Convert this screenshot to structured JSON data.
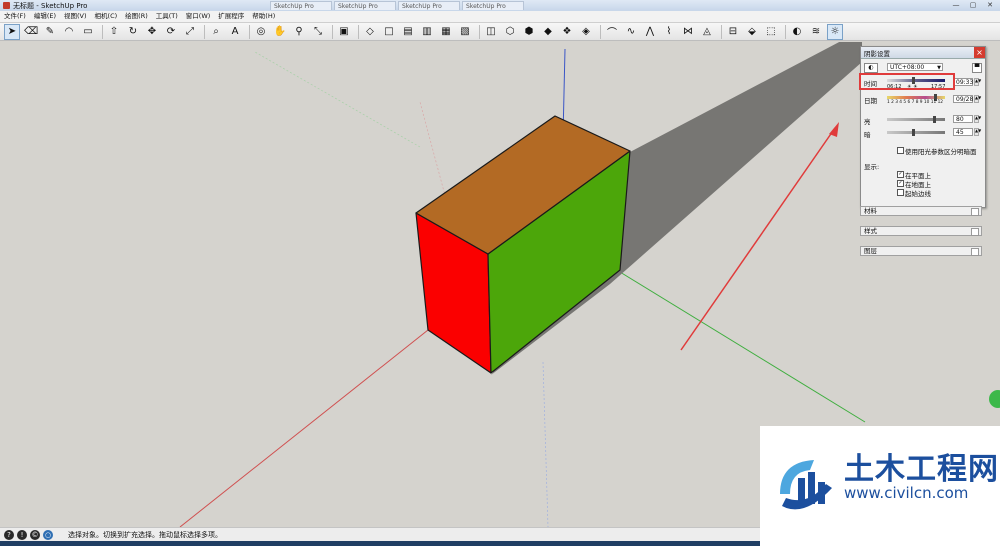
{
  "window": {
    "title": "无标题 - SketchUp Pro",
    "tabs": [
      "SketchUp Pro",
      "SketchUp Pro",
      "SketchUp Pro",
      "SketchUp Pro"
    ],
    "controls": {
      "minimize": "—",
      "maximize": "▢",
      "close": "✕"
    }
  },
  "menu": [
    "文件(F)",
    "编辑(E)",
    "视图(V)",
    "相机(C)",
    "绘图(R)",
    "工具(T)",
    "窗口(W)",
    "扩展程序",
    "帮助(H)"
  ],
  "toolbar": {
    "tools": [
      {
        "name": "select-tool",
        "glyph": "➤",
        "active": true
      },
      {
        "name": "eraser-tool",
        "glyph": "⌫"
      },
      {
        "name": "pencil-tool",
        "glyph": "✎"
      },
      {
        "name": "arc-tool",
        "glyph": "◠"
      },
      {
        "name": "rectangle-tool",
        "glyph": "▭"
      },
      {
        "name": "pushpull-tool",
        "glyph": "⇧"
      },
      {
        "name": "followme-tool",
        "glyph": "↻"
      },
      {
        "name": "move-tool",
        "glyph": "✥"
      },
      {
        "name": "rotate-tool",
        "glyph": "⟳"
      },
      {
        "name": "scale-tool",
        "glyph": "⤢"
      },
      {
        "name": "tape-tool",
        "glyph": "⌕"
      },
      {
        "name": "text-tool",
        "glyph": "A"
      },
      {
        "name": "orbit-tool",
        "glyph": "◎"
      },
      {
        "name": "pan-tool",
        "glyph": "✋"
      },
      {
        "name": "zoom-tool",
        "glyph": "⚲"
      },
      {
        "name": "zoom-extents-tool",
        "glyph": "⤡"
      },
      {
        "name": "warehouse-tool",
        "glyph": "▣"
      },
      {
        "name": "iso-view",
        "glyph": "◇"
      },
      {
        "name": "top-view",
        "glyph": "□"
      },
      {
        "name": "front-view",
        "glyph": "▤"
      },
      {
        "name": "right-view",
        "glyph": "▥"
      },
      {
        "name": "back-view",
        "glyph": "▦"
      },
      {
        "name": "left-view",
        "glyph": "▧"
      },
      {
        "name": "xray-style",
        "glyph": "◫"
      },
      {
        "name": "wireframe-style",
        "glyph": "⬡"
      },
      {
        "name": "hidden-style",
        "glyph": "⬢"
      },
      {
        "name": "shaded-style",
        "glyph": "◆"
      },
      {
        "name": "textured-style",
        "glyph": "❖"
      },
      {
        "name": "monochrome-style",
        "glyph": "◈"
      },
      {
        "name": "sandbox-1",
        "glyph": "⌒"
      },
      {
        "name": "sandbox-2",
        "glyph": "∿"
      },
      {
        "name": "sandbox-3",
        "glyph": "⋀"
      },
      {
        "name": "sandbox-4",
        "glyph": "⌇"
      },
      {
        "name": "sandbox-5",
        "glyph": "⋈"
      },
      {
        "name": "sandbox-6",
        "glyph": "◬"
      },
      {
        "name": "section-tool",
        "glyph": "⊟"
      },
      {
        "name": "component-tool",
        "glyph": "⬙"
      },
      {
        "name": "group-tool",
        "glyph": "⬚"
      },
      {
        "name": "shadows-toggle",
        "glyph": "◐"
      },
      {
        "name": "fog-toggle",
        "glyph": "≋"
      },
      {
        "name": "shadow-settings",
        "glyph": "☼",
        "active": true
      }
    ]
  },
  "scene": {
    "colors": {
      "top": "#b36a24",
      "front": "#4ca60a",
      "left": "#fb0000",
      "shadow": "#777673",
      "ground": "#d5d3ce",
      "axis_red": "#d05050",
      "axis_green": "#3fae3f",
      "axis_blue": "#3a55c6",
      "annotation": "#e03b3b"
    }
  },
  "shadow_panel": {
    "title": "阴影设置",
    "timezone": "UTC+08:00",
    "time_label": "时间",
    "time_start": "06:12",
    "time_end": "17:57",
    "time_value": "09:33",
    "date_label": "日期",
    "date_ticks": "1 2 3 4 5 6 7 8 9 10 11 12",
    "date_value": "09/28",
    "light_label": "亮",
    "light_value": "80",
    "dark_label": "暗",
    "dark_value": "45",
    "sun_shading_label": "使用阳光参数区分明暗面",
    "display_label": "显示:",
    "on_faces_label": "在平面上",
    "on_ground_label": "在地面上",
    "from_edges_label": "起始边线",
    "on_faces_checked": true,
    "on_ground_checked": true,
    "from_edges_checked": false
  },
  "trays": [
    "材料",
    "样式",
    "图层"
  ],
  "status": {
    "text": "选择对象。切换到扩充选择。拖动鼠标选择多项。"
  },
  "watermark": {
    "text": "土木工程网",
    "url": "www.civilcn.com"
  }
}
